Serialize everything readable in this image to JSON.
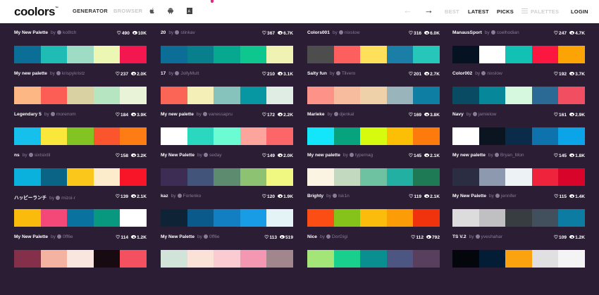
{
  "header": {
    "logo": "coolors",
    "logo_tm": "™",
    "nav_generator": "GENERATOR",
    "nav_browser": "BROWSER",
    "nav_best": "BEST",
    "nav_latest": "LATEST",
    "nav_picks": "PICKS",
    "nav_palettes": "PALETTES",
    "nav_login": "LOGIN",
    "arrow_prev": "←",
    "arrow_next": "→"
  },
  "by_label": "by",
  "palettes": [
    {
      "name": "My New Palette",
      "user": "ko8tch",
      "likes": "490",
      "views": "10K",
      "colors": [
        "#0b6e97",
        "#1fbcb5",
        "#9fdcc6",
        "#ecf7b4",
        "#f4164f"
      ]
    },
    {
      "name": "20",
      "user": "stinkav",
      "likes": "367",
      "views": "6.7K",
      "colors": [
        "#0c6d97",
        "#087f8c",
        "#06a88f",
        "#0ec78f",
        "#f0f2b4"
      ]
    },
    {
      "name": "Colors001",
      "user": "nixslow",
      "likes": "316",
      "views": "6.0K",
      "colors": [
        "#4d4d4d",
        "#fd5e5e",
        "#ffe05a",
        "#1a7ea6",
        "#26c6bb"
      ]
    },
    {
      "name": "ManausSport",
      "user": "coelhodian",
      "likes": "247",
      "views": "4.7K",
      "colors": [
        "#041222",
        "#ffffff",
        "#10c1b4",
        "#fb1740",
        "#fca306"
      ]
    },
    {
      "name": "My new palette",
      "user": "krispykristz",
      "likes": "237",
      "views": "2.0K",
      "colors": [
        "#fcb785",
        "#fc5d54",
        "#d9d1a2",
        "#b6e5c2",
        "#e9f3d7"
      ]
    },
    {
      "name": "17",
      "user": "JollyMutt",
      "likes": "210",
      "views": "3.1K",
      "colors": [
        "#fb6556",
        "#f4efb7",
        "#85c3bc",
        "#0797a3",
        "#e0ede5"
      ]
    },
    {
      "name": "Salty fun",
      "user": "Tilvero",
      "likes": "201",
      "views": "2.7K",
      "colors": [
        "#fd9388",
        "#f6bc9d",
        "#eed1a9",
        "#99b4bb",
        "#0f7ea3"
      ]
    },
    {
      "name": "Color002",
      "user": "nixslow",
      "likes": "192",
      "views": "3.7K",
      "colors": [
        "#084b63",
        "#06879a",
        "#d5f8de",
        "#2b6a94",
        "#f14f61"
      ]
    },
    {
      "name": "Legendary 5",
      "user": "morenom",
      "likes": "184",
      "views": "3.9K",
      "colors": [
        "#15c1ec",
        "#fae73b",
        "#82c422",
        "#fb552d",
        "#fd7d14"
      ]
    },
    {
      "name": "My new palette",
      "user": "vanessapru",
      "likes": "172",
      "views": "2.2K",
      "colors": [
        "#ffffff",
        "#2ad8c0",
        "#6bfcd3",
        "#fda49c",
        "#fd6669"
      ]
    },
    {
      "name": "Marieke",
      "user": "djenkal",
      "likes": "169",
      "views": "3.8K",
      "colors": [
        "#13e5fb",
        "#07a37f",
        "#d7fb0f",
        "#fdbe06",
        "#fd7a0c"
      ]
    },
    {
      "name": "Navy",
      "user": "jamielow",
      "likes": "161",
      "views": "2.9K",
      "colors": [
        "#ffffff",
        "#0a1520",
        "#0a2c4a",
        "#0e72ad",
        "#0ca4e8"
      ]
    },
    {
      "name": "ns",
      "user": "sixtsixtil",
      "likes": "158",
      "views": "3.2K",
      "colors": [
        "#0bb1dd",
        "#0a6486",
        "#fac71a",
        "#fceccb",
        "#f81528"
      ]
    },
    {
      "name": "My New Palette",
      "user": "seday",
      "likes": "149",
      "views": "2.0K",
      "colors": [
        "#3d2d55",
        "#43547a",
        "#5d8b70",
        "#8dc273",
        "#f1f882"
      ]
    },
    {
      "name": "My new palette",
      "user": "typemag",
      "likes": "145",
      "views": "2.1K",
      "colors": [
        "#fbf4e2",
        "#c2d9bf",
        "#6ec2a2",
        "#21b0a2",
        "#1e7a55"
      ]
    },
    {
      "name": "My new palette",
      "user": "Bryan_Mon",
      "likes": "145",
      "views": "1.8K",
      "colors": [
        "#2b2d42",
        "#8d99ae",
        "#edf2f4",
        "#ef233c",
        "#d90429"
      ]
    },
    {
      "name": "ハッピーランチ",
      "user": "mizoi-r",
      "likes": "139",
      "views": "2.1K",
      "colors": [
        "#fbbb0d",
        "#f44878",
        "#09729f",
        "#07987f",
        "#ffffff"
      ]
    },
    {
      "name": "kaz",
      "user": "Forlenko",
      "likes": "120",
      "views": "1.9K",
      "colors": [
        "#0e2335",
        "#0b5a8c",
        "#117fc1",
        "#179ce5",
        "#e4f3f6"
      ]
    },
    {
      "name": "Brighty",
      "user": "Isk1n",
      "likes": "119",
      "views": "2.1K",
      "colors": [
        "#fc4e14",
        "#86c31a",
        "#fcbc0c",
        "#fc9d08",
        "#f0330c"
      ]
    },
    {
      "name": "My New Palette",
      "user": "jennifer",
      "likes": "115",
      "views": "1.4K",
      "colors": [
        "#dcdcdc",
        "#c0bfc2",
        "#373d40",
        "#424f5c",
        "#0c7ca3"
      ]
    },
    {
      "name": "My New Palette",
      "user": "0ff6e",
      "likes": "114",
      "views": "1.2K",
      "colors": [
        "#84304a",
        "#f4b2a1",
        "#f8e6df",
        "#170a10",
        "#f4505f"
      ]
    },
    {
      "name": "My New Palette",
      "user": "0ff6e",
      "likes": "113",
      "views": "519",
      "colors": [
        "#d2e3da",
        "#fbe2d9",
        "#fbcbd2",
        "#f497b3",
        "#a2868d"
      ]
    },
    {
      "name": "Nice",
      "user": "DorGigi",
      "likes": "112",
      "views": "792",
      "colors": [
        "#a3e577",
        "#18cf8e",
        "#0a8f91",
        "#4d5583",
        "#593f5e"
      ]
    },
    {
      "name": "TS V.2",
      "user": "yveshahar",
      "likes": "109",
      "views": "1.2K",
      "colors": [
        "#03070c",
        "#021d35",
        "#fba30f",
        "#e0e0e0",
        "#f4f4f4"
      ]
    }
  ]
}
